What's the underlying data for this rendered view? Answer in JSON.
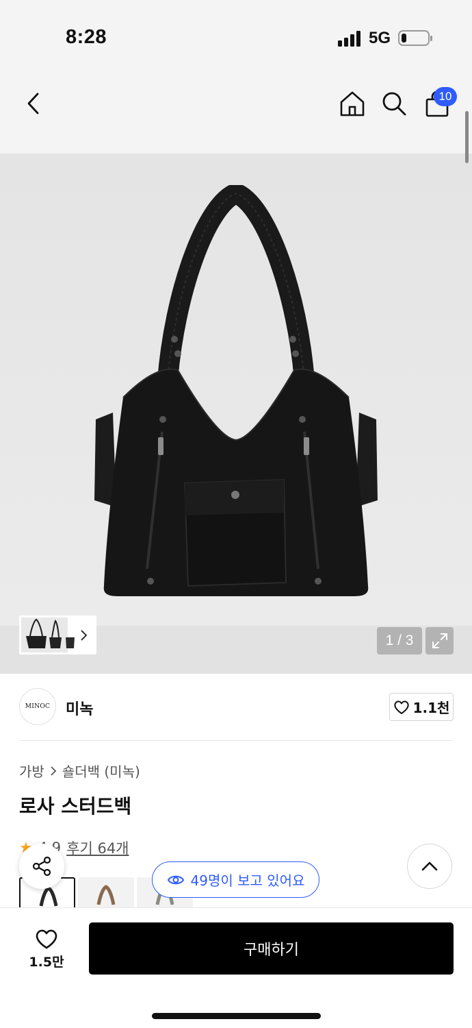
{
  "status_bar": {
    "time": "8:28",
    "network": "5G",
    "battery_level": 0.2
  },
  "header": {
    "back_icon": "chevron-left-icon",
    "home_icon": "home-icon",
    "search_icon": "search-icon",
    "cart_icon": "shopping-bag-icon",
    "cart_count": "10"
  },
  "gallery": {
    "page_counter": "1 / 3",
    "expand_icon": "expand-icon",
    "thumb_chevron_icon": "chevron-right-icon"
  },
  "brand": {
    "logo_text": "MINOC",
    "name": "미녹",
    "like_count": "1.1천"
  },
  "product": {
    "breadcrumb": [
      "가방",
      "숄더백 (미녹)"
    ],
    "title": "로사 스터드백",
    "rating": "4.9",
    "review_link": "후기 64개"
  },
  "colors": {
    "accent": "#2f5bff",
    "rating_star": "#f5a623",
    "swatch_colors": [
      "#2a2a2a",
      "#8a6a4f",
      "#8d8a86"
    ]
  },
  "floating": {
    "share_icon": "share-icon",
    "scroll_top_icon": "chevron-up-icon",
    "viewers_text": "49명이 보고 있어요"
  },
  "bottom_bar": {
    "wish_count": "1.5만",
    "buy_label": "구매하기"
  }
}
